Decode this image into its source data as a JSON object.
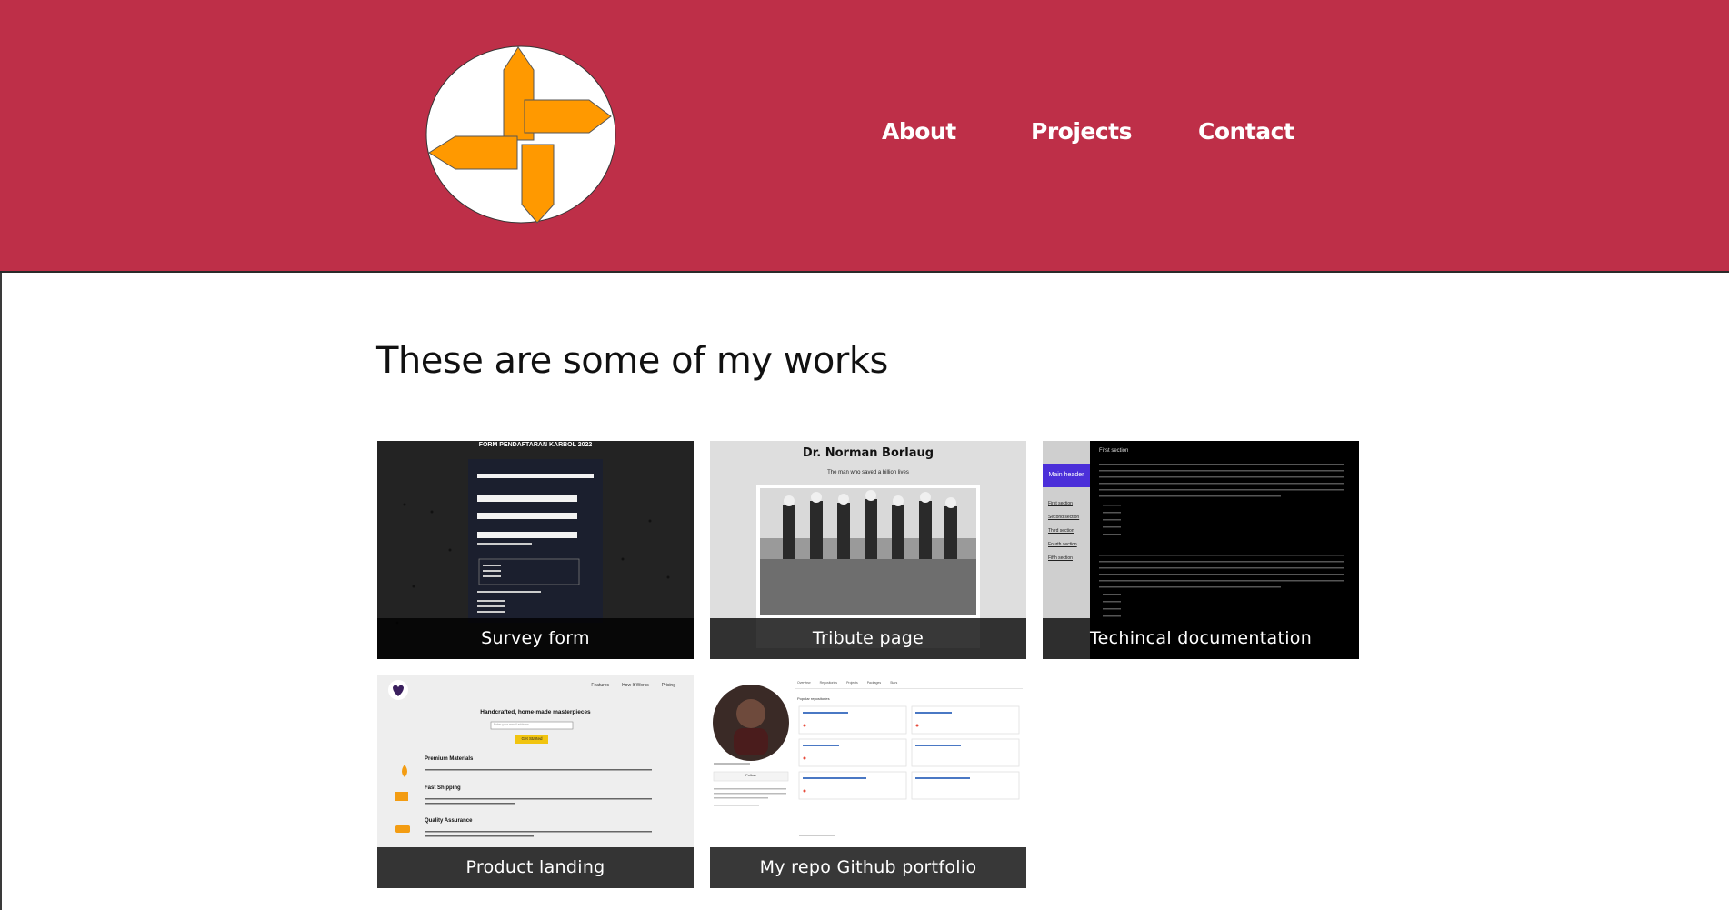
{
  "nav": {
    "about": "About",
    "projects": "Projects",
    "contact": "Contact"
  },
  "main": {
    "heading": "These are some of my works"
  },
  "projects": [
    {
      "caption": "Survey form",
      "thumb_title": "FORM PENDAFTARAN KARBOL 2022"
    },
    {
      "caption": "Tribute page",
      "thumb_title": "Dr. Norman Borlaug",
      "thumb_subtitle": "The man who saved a billion lives"
    },
    {
      "caption": "Techincal documentation",
      "thumb_header": "Main header",
      "thumb_links": [
        "First section",
        "Second section",
        "Third section",
        "Fourth section",
        "Fifth section"
      ],
      "thumb_section_title": "First section"
    },
    {
      "caption": "Product landing",
      "thumb_nav": [
        "Features",
        "How It Works",
        "Pricing"
      ],
      "thumb_title": "Handcrafted, home-made masterpieces",
      "thumb_input_placeholder": "Enter your email address",
      "thumb_button": "Get Started",
      "thumb_features": [
        "Premium Materials",
        "Fast Shipping",
        "Quality Assurance"
      ]
    },
    {
      "caption": "My repo Github portfolio",
      "thumb_tabs": [
        "Overview",
        "Repositories",
        "Projects",
        "Packages",
        "Stars"
      ],
      "thumb_section": "Popular repositories",
      "thumb_follow": "Follow"
    }
  ],
  "colors": {
    "header_bg": "#be2f48",
    "logo_orange": "#ff9900",
    "caption_bg": "rgba(0,0,0,0.78)"
  }
}
